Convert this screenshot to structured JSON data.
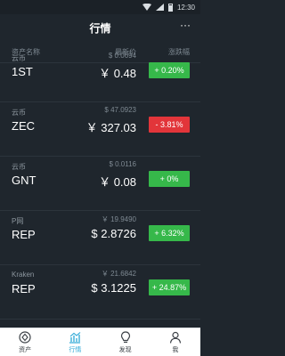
{
  "status": {
    "time": "12:30"
  },
  "nav": {
    "title": "行情",
    "more_label": "···"
  },
  "columns": {
    "asset": "资产名称",
    "latest": "最新价",
    "change": "涨跌幅"
  },
  "rows": [
    {
      "exchange": "云币",
      "symbol": "1ST",
      "sub_price": "$ 0.0694",
      "price": "￥ 0.48",
      "change": "+ 0.20%",
      "direction": "up"
    },
    {
      "exchange": "云币",
      "symbol": "ZEC",
      "sub_price": "$ 47.0923",
      "price": "￥ 327.03",
      "change": "- 3.81%",
      "direction": "down"
    },
    {
      "exchange": "云币",
      "symbol": "GNT",
      "sub_price": "$ 0.0116",
      "price": "￥ 0.08",
      "change": "+ 0%",
      "direction": "up"
    },
    {
      "exchange": "P网",
      "symbol": "REP",
      "sub_price": "￥ 19.9490",
      "price": "$ 2.8726",
      "change": "+ 6.32%",
      "direction": "up"
    },
    {
      "exchange": "Kraken",
      "symbol": "REP",
      "sub_price": "￥ 21.6842",
      "price": "$ 3.1225",
      "change": "+ 24.87%",
      "direction": "up"
    }
  ],
  "tabs": [
    {
      "label": "资产",
      "icon": "asset-icon",
      "active": false
    },
    {
      "label": "行情",
      "icon": "market-chart-icon",
      "active": true
    },
    {
      "label": "发现",
      "icon": "discover-bulb-icon",
      "active": false
    },
    {
      "label": "我",
      "icon": "profile-icon",
      "active": false
    }
  ],
  "colors": {
    "background": "#1f262d",
    "up": "#36b84a",
    "down": "#e2353a",
    "accent": "#2aa7d6"
  }
}
